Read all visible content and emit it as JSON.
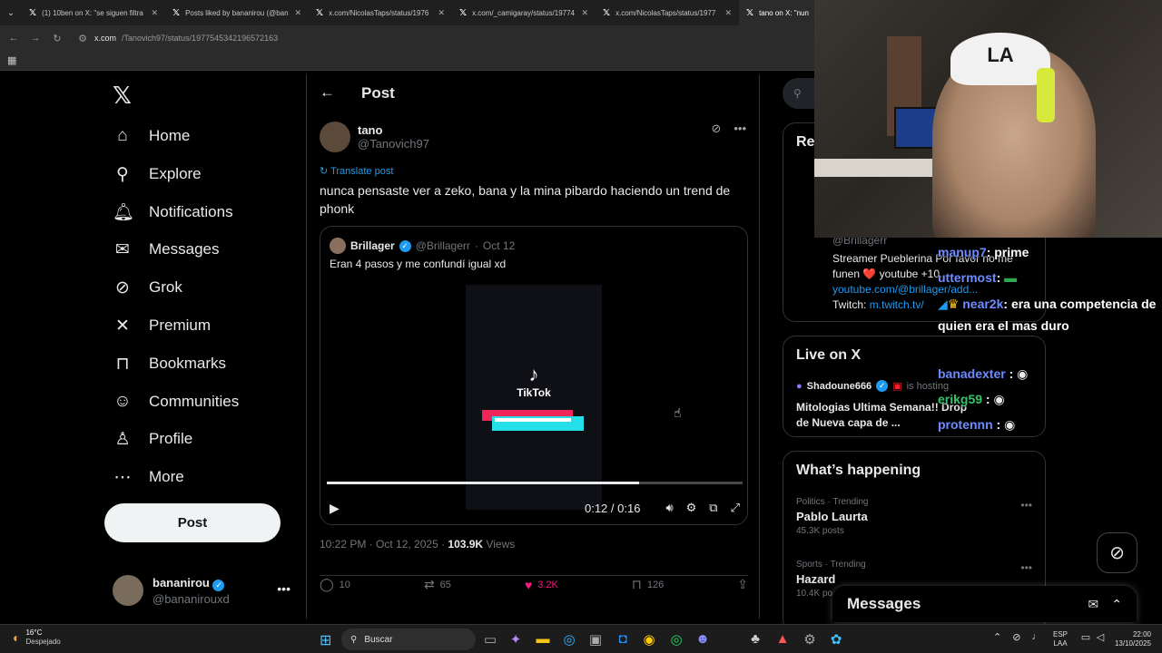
{
  "browser": {
    "tabs": [
      {
        "title": "(1) 10ben on X: \"se siguen filtra",
        "active": false
      },
      {
        "title": "Posts liked by bananirou (@ban",
        "active": false
      },
      {
        "title": "x.com/NicolasTaps/status/1976",
        "active": false
      },
      {
        "title": "x.com/_camigaray/status/19774",
        "active": false
      },
      {
        "title": "x.com/NicolasTaps/status/1977",
        "active": false
      },
      {
        "title": "tano on X: \"nun",
        "active": true
      }
    ],
    "url_host": "x.com",
    "url_path": "/Tanovich97/status/1977545342196572163"
  },
  "nav": {
    "items": [
      {
        "label": "Home",
        "icon": "home-icon",
        "glyph": "⌂"
      },
      {
        "label": "Explore",
        "icon": "search-icon",
        "glyph": "⚲"
      },
      {
        "label": "Notifications",
        "icon": "bell-icon",
        "glyph": "♫"
      },
      {
        "label": "Messages",
        "icon": "mail-icon",
        "glyph": "✉"
      },
      {
        "label": "Grok",
        "icon": "grok-icon",
        "glyph": "⊘"
      },
      {
        "label": "Premium",
        "icon": "x-logo-icon",
        "glyph": "✕"
      },
      {
        "label": "Bookmarks",
        "icon": "bookmark-icon",
        "glyph": "⊓"
      },
      {
        "label": "Communities",
        "icon": "people-icon",
        "glyph": "☺"
      },
      {
        "label": "Profile",
        "icon": "person-icon",
        "glyph": "♙"
      },
      {
        "label": "More",
        "icon": "more-circle-icon",
        "glyph": "⋯"
      }
    ],
    "post_button": "Post",
    "account": {
      "name": "bananirou",
      "handle": "@bananirouxd"
    }
  },
  "post": {
    "header_title": "Post",
    "author_name": "tano",
    "author_handle": "@Tanovich97",
    "translate": "Translate post",
    "text": "nunca pensaste ver a zeko, bana y la mina pibardo haciendo un trend de phonk",
    "quote": {
      "name": "Brillager",
      "handle": "@Brillagerr",
      "date": "Oct 12",
      "text": "Eran 4 pasos y me confundí igual xd",
      "video_brand": "TikTok",
      "time": "0:12 / 0:16",
      "progress": 0.75
    },
    "timestamp": "10:22 PM · Oct 12, 2025 · ",
    "views": "103.9K",
    "views_label": " Views",
    "actions": {
      "replies": "10",
      "reposts": "65",
      "likes": "3.2K",
      "bookmarks": "126"
    }
  },
  "sidebar": {
    "relevant_title": "Re",
    "bio": {
      "handle": "@Brillagerr",
      "line1": "Streamer Pueblerina Por favor no me",
      "line2": "funen ❤️ youtube +10...",
      "link": "youtube.com/@brillager/add...",
      "twitch_prefix": "Twitch: ",
      "twitch_link": "m.twitch.tv/"
    },
    "live": {
      "title": "Live on X",
      "host": "Shadoune666",
      "hosting": "is hosting",
      "stream_title": "Mitologias Ultima Semana!! Drop de Nueva capa de ..."
    },
    "happening": {
      "title": "What’s happening",
      "trends": [
        {
          "context": "Politics · Trending",
          "name": "Pablo Laurta",
          "count": "45.3K posts"
        },
        {
          "context": "Sports · Trending",
          "name": "Hazard",
          "count": "10.4K po"
        }
      ]
    },
    "messages_dock": "Messages"
  },
  "stream": {
    "cap_logo": "LA",
    "chat": [
      {
        "user": "manup7",
        "msg": ": prime"
      },
      {
        "user": "uttermost",
        "msg": ": "
      },
      {
        "user": "near2k",
        "msg": ": era una competencia de quien era el mas duro"
      },
      {
        "user": "banadexter",
        "msg": " : "
      },
      {
        "user": "erikg59",
        "msg": " : "
      },
      {
        "user": "protennn",
        "msg": " : "
      }
    ]
  },
  "taskbar": {
    "temp": "16°C",
    "weather": "Despejado",
    "search": "Buscar",
    "lang1": "ESP",
    "lang2": "LAA",
    "time": "22:00",
    "date": "13/10/2025"
  },
  "colors": {
    "accent": "#1d9bf0",
    "like": "#f91880",
    "background": "#000000"
  }
}
